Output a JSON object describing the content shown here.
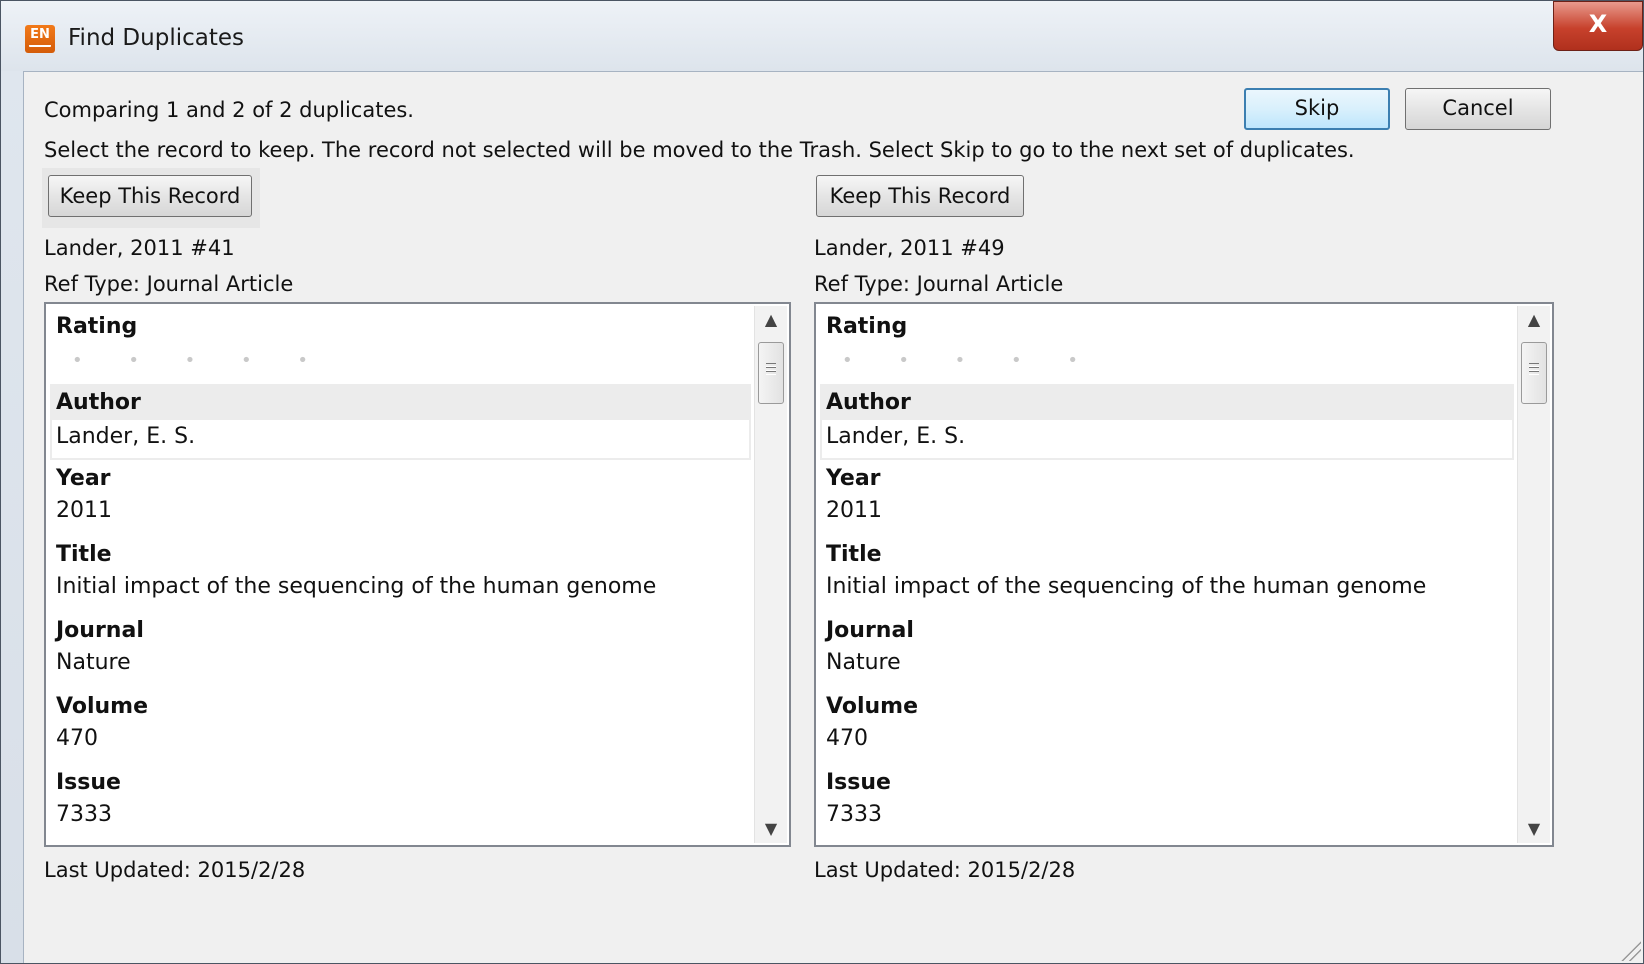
{
  "window": {
    "title": "Find Duplicates",
    "app_icon": "EN",
    "close_label": "X"
  },
  "header": {
    "comparing_text": "Comparing 1 and 2 of 2 duplicates.",
    "instructions": "Select the record to keep. The record not selected will be moved to the Trash. Select Skip to go to the next set of duplicates.",
    "skip_label": "Skip",
    "cancel_label": "Cancel"
  },
  "records": [
    {
      "keep_label": "Keep This Record",
      "citation": "Lander, 2011 #41",
      "ref_type": "Ref Type: Journal Article",
      "rating_label": "Rating",
      "rating_value": 0,
      "fields": [
        {
          "label": "Author",
          "value": "Lander, E. S."
        },
        {
          "label": "Year",
          "value": "2011"
        },
        {
          "label": "Title",
          "value": "Initial impact of the sequencing of the human genome"
        },
        {
          "label": "Journal",
          "value": "Nature"
        },
        {
          "label": "Volume",
          "value": "470"
        },
        {
          "label": "Issue",
          "value": "7333"
        }
      ],
      "last_updated": "Last Updated: 2015/2/28"
    },
    {
      "keep_label": "Keep This Record",
      "citation": "Lander, 2011 #49",
      "ref_type": "Ref Type: Journal Article",
      "rating_label": "Rating",
      "rating_value": 0,
      "fields": [
        {
          "label": "Author",
          "value": "Lander, E. S."
        },
        {
          "label": "Year",
          "value": "2011"
        },
        {
          "label": "Title",
          "value": "Initial impact of the sequencing of the human genome"
        },
        {
          "label": "Journal",
          "value": "Nature"
        },
        {
          "label": "Volume",
          "value": "470"
        },
        {
          "label": "Issue",
          "value": "7333"
        }
      ],
      "last_updated": "Last Updated: 2015/2/28"
    }
  ],
  "icons": {
    "scroll_up": "chevron-up-icon",
    "scroll_down": "chevron-down-icon",
    "rating": "rating-dots-icon"
  }
}
